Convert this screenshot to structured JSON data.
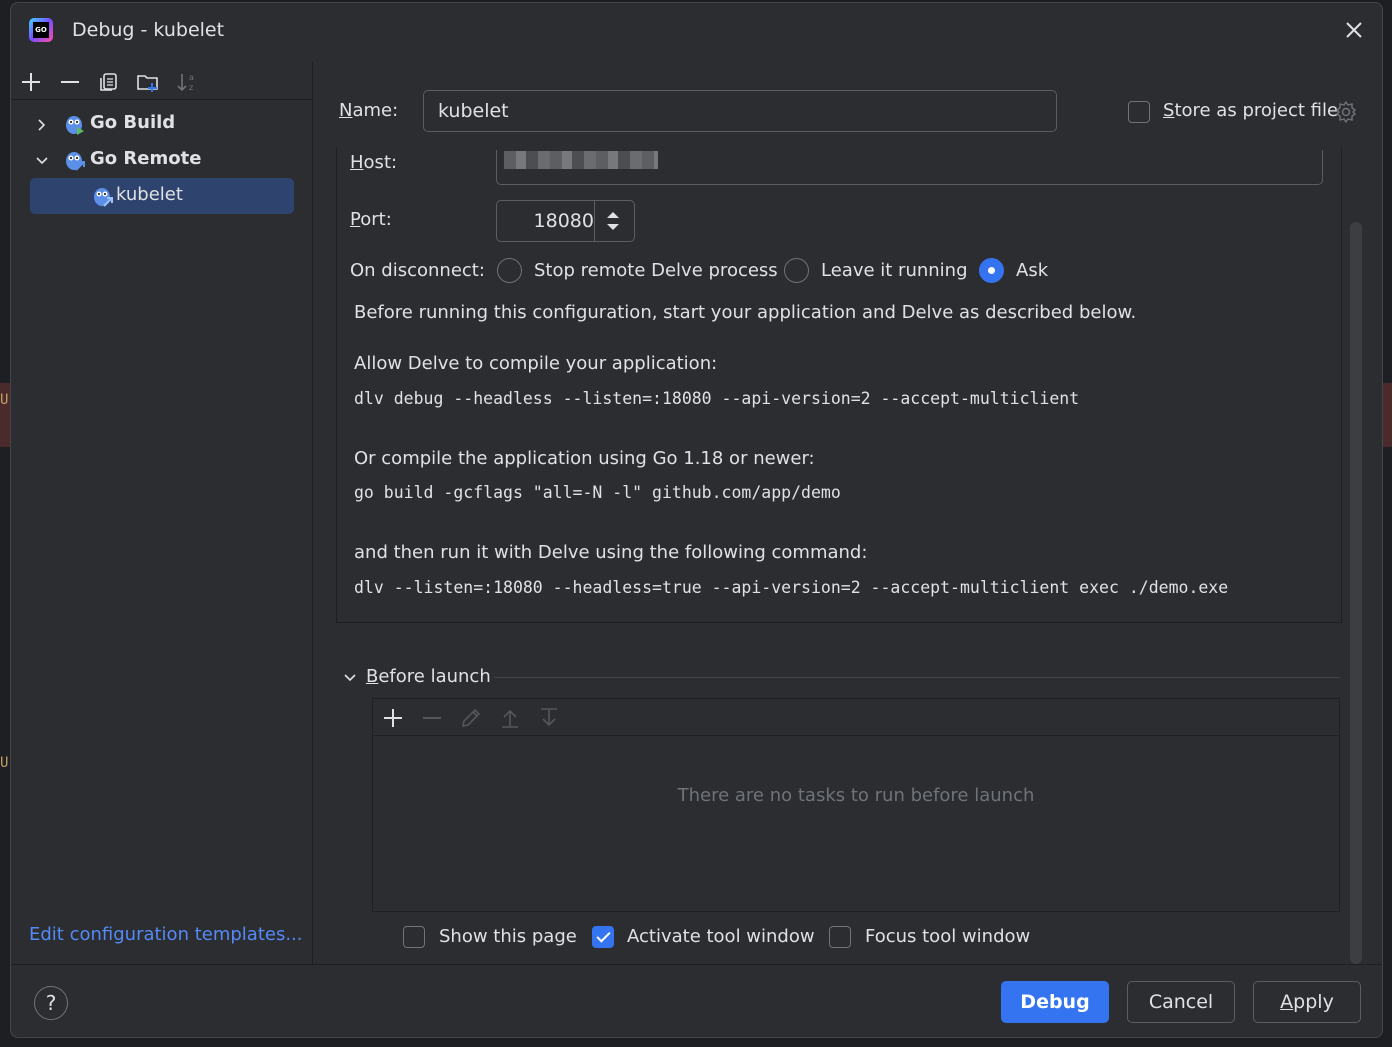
{
  "window": {
    "title": "Debug - kubelet",
    "app_icon": "goland-icon",
    "close_icon": "close-icon"
  },
  "left": {
    "toolbar": [
      "add-icon",
      "remove-icon",
      "copy-icon",
      "new-folder-icon",
      "sort-icon"
    ],
    "tree": [
      {
        "label": "Go Build",
        "expanded": false,
        "icon": "gopher-build-icon"
      },
      {
        "label": "Go Remote",
        "expanded": true,
        "icon": "gopher-remote-icon"
      },
      {
        "label": "kubelet",
        "selected": true,
        "icon": "gopher-remote-icon"
      }
    ],
    "edit_templates": "Edit configuration templates..."
  },
  "config": {
    "name_label_u": "N",
    "name_label_rest": "ame:",
    "name_value": "kubelet",
    "store_label_u": "S",
    "store_label_rest": "tore as project file",
    "store_checked": false,
    "host_label_u": "H",
    "host_label_rest": "ost:",
    "port_label_u": "P",
    "port_label_rest": "ort:",
    "port_value": "18080",
    "on_disconnect_label": "On disconnect:",
    "disconnect_options": [
      {
        "label": "Stop remote Delve process",
        "selected": false
      },
      {
        "label": "Leave it running",
        "selected": false
      },
      {
        "label": "Ask",
        "selected": true
      }
    ],
    "intro": "Before running this configuration, start your application and Delve as described below.",
    "allow_text": "Allow Delve to compile your application:",
    "allow_cmd": "dlv debug --headless --listen=:18080 --api-version=2 --accept-multiclient",
    "or_text": "Or compile the application using Go 1.18 or newer:",
    "or_cmd": "go build -gcflags \"all=-N -l\" github.com/app/demo",
    "then_text": "and then run it with Delve using the following command:",
    "then_cmd": "dlv --listen=:18080 --headless=true --api-version=2 --accept-multiclient exec ./demo.exe"
  },
  "before_launch": {
    "title_u": "B",
    "title_rest": "efore launch",
    "toolbar": [
      "add-icon",
      "remove-icon",
      "edit-icon",
      "move-up-icon",
      "move-down-icon"
    ],
    "empty_text": "There are no tasks to run before launch",
    "options": [
      {
        "label": "Show this page",
        "checked": false
      },
      {
        "label": "Activate tool window",
        "checked": true
      },
      {
        "label": "Focus tool window",
        "checked": false
      }
    ]
  },
  "footer": {
    "help": "?",
    "debug": "Debug",
    "cancel": "Cancel",
    "apply_u": "A",
    "apply_rest": "pply"
  },
  "colors": {
    "accent": "#3574f0",
    "selection": "#2e436e",
    "link": "#548af7",
    "background": "#2b2d30"
  }
}
